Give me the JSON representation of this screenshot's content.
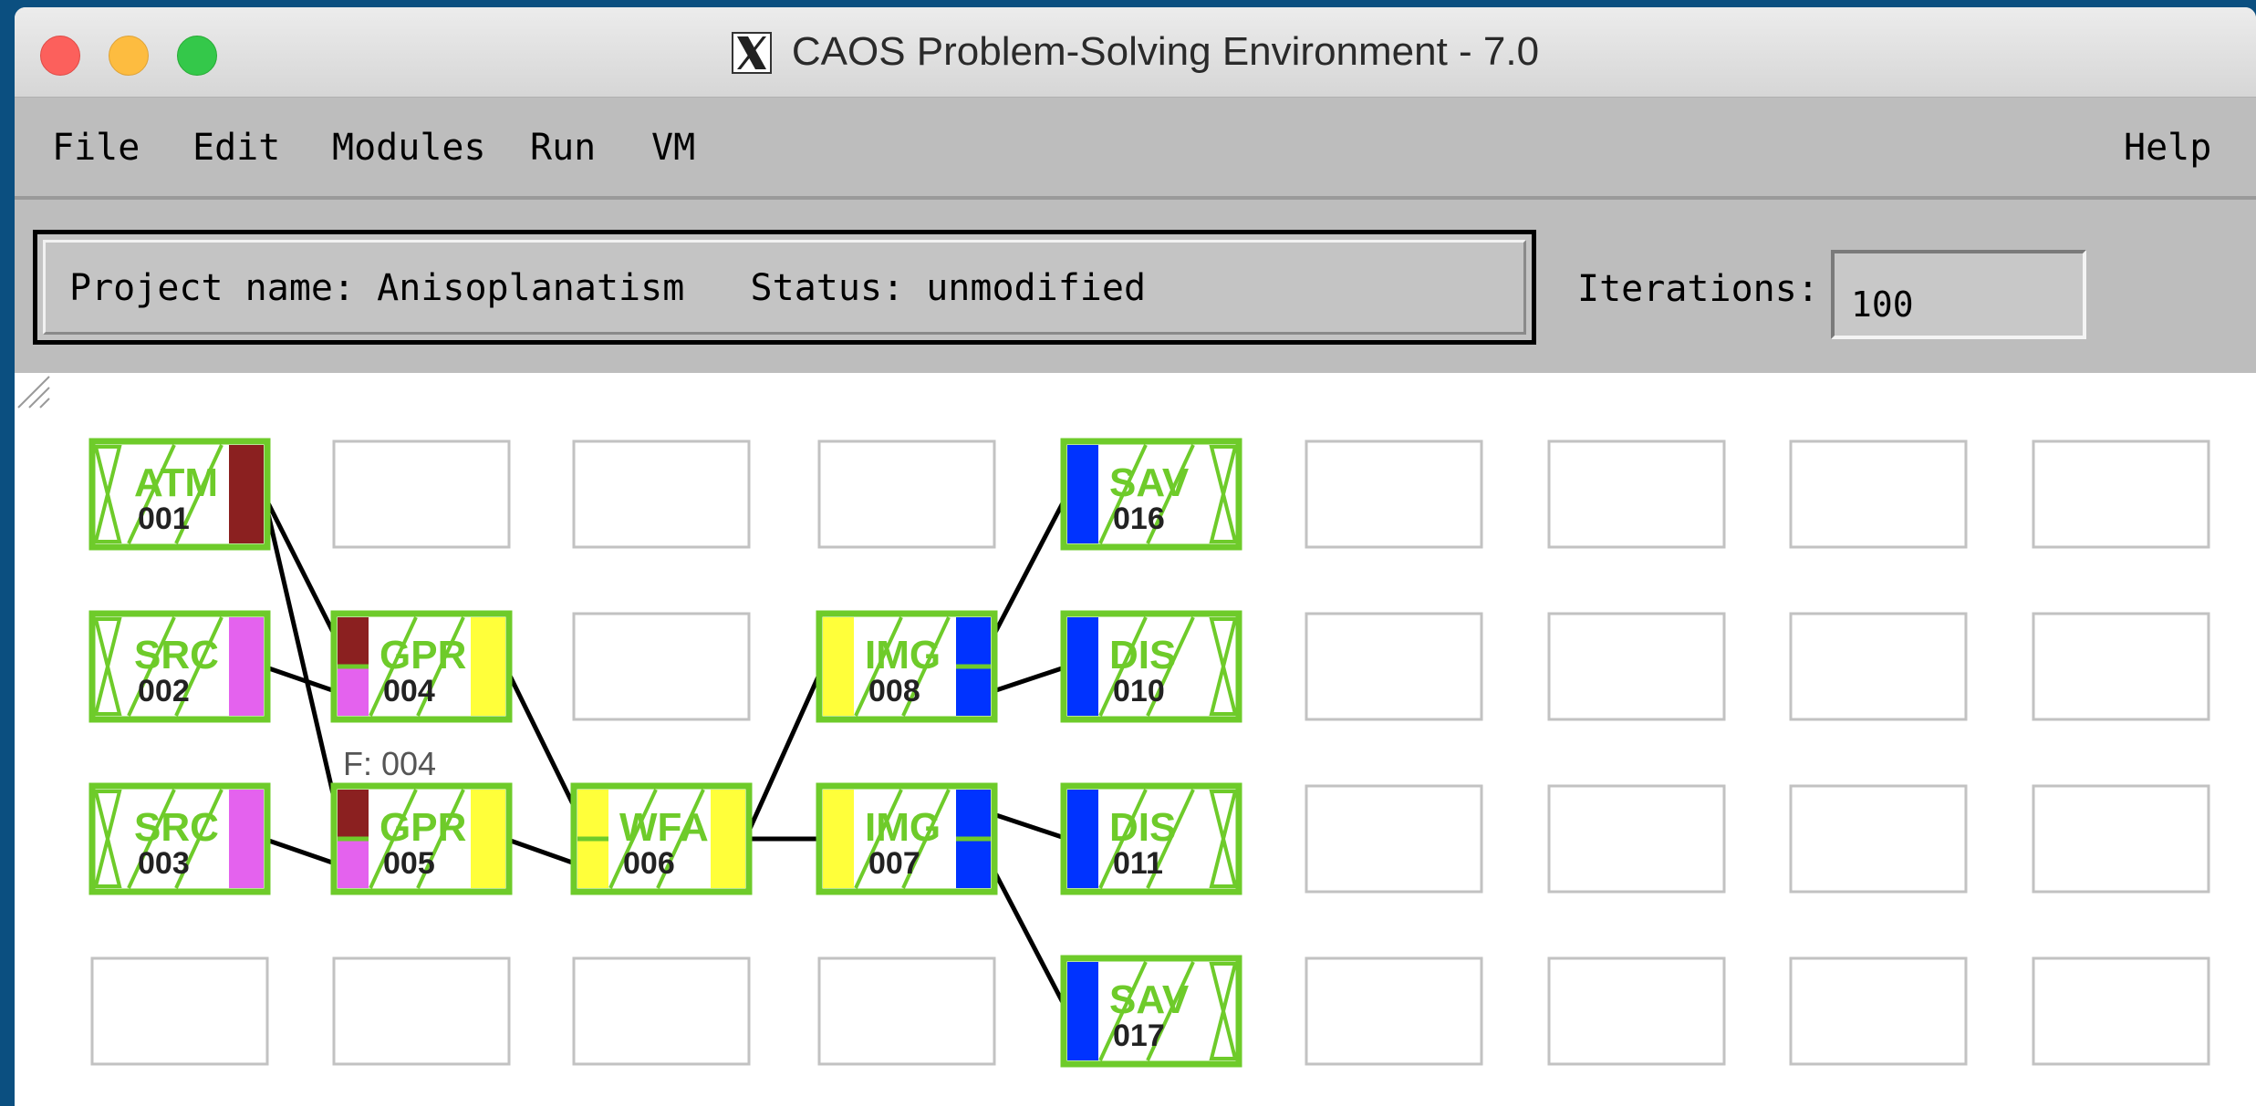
{
  "window": {
    "title": "CAOS Problem-Solving Environment - 7.0",
    "title_icon": "x11-logo-icon"
  },
  "menubar": {
    "file": "File",
    "edit": "Edit",
    "modules": "Modules",
    "run": "Run",
    "vm": "VM",
    "help": "Help"
  },
  "project": {
    "text": "Project name: Anisoplanatism   Status: unmodified"
  },
  "iterations": {
    "label": "Iterations:",
    "value": "100"
  },
  "colors": {
    "module_green": "#6ecb2a",
    "atm_port": "#8b2020",
    "src_port": "#e462ee",
    "wfs_port": "#ffff3a",
    "img_port": "#0033ff"
  },
  "modules": [
    {
      "id": "atm-001",
      "name": "ATM",
      "num": "001"
    },
    {
      "id": "src-002",
      "name": "SRC",
      "num": "002"
    },
    {
      "id": "src-003",
      "name": "SRC",
      "num": "003"
    },
    {
      "id": "gpr-004",
      "name": "GPR",
      "num": "004"
    },
    {
      "id": "gpr-005",
      "name": "GPR",
      "num": "005"
    },
    {
      "id": "wfa-006",
      "name": "WFA",
      "num": "006"
    },
    {
      "id": "img-008",
      "name": "IMG",
      "num": "008"
    },
    {
      "id": "img-007",
      "name": "IMG",
      "num": "007"
    },
    {
      "id": "sav-016",
      "name": "SAV",
      "num": "016"
    },
    {
      "id": "dis-010",
      "name": "DIS",
      "num": "010"
    },
    {
      "id": "dis-011",
      "name": "DIS",
      "num": "011"
    },
    {
      "id": "sav-017",
      "name": "SAV",
      "num": "017"
    }
  ],
  "feedback_label": "F: 004"
}
